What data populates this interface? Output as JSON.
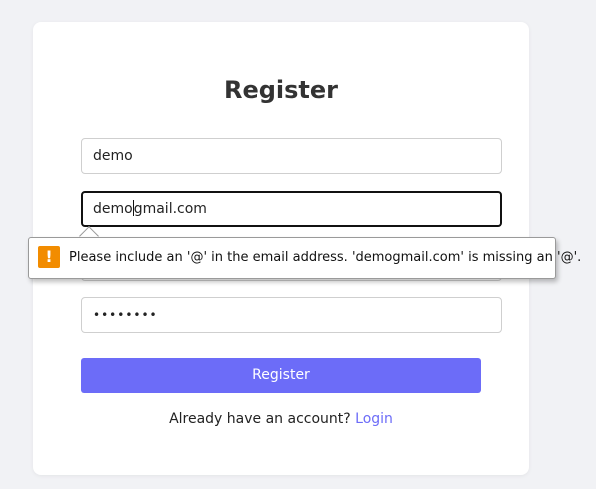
{
  "form": {
    "title": "Register",
    "fields": {
      "username_value": "demo",
      "email_value_before_caret": "demo",
      "email_value_after_caret": "gmail.com",
      "password_masked": "••••••••"
    },
    "submit_label": "Register",
    "footer_text": "Already have an account?",
    "footer_link": "Login"
  },
  "validation": {
    "icon": "warning-icon",
    "icon_glyph": "!",
    "message": "Please include an '@' in the email address. 'demogmail.com' is missing an '@'."
  },
  "colors": {
    "accent": "#6c6cf8",
    "warning": "#f28c00"
  }
}
